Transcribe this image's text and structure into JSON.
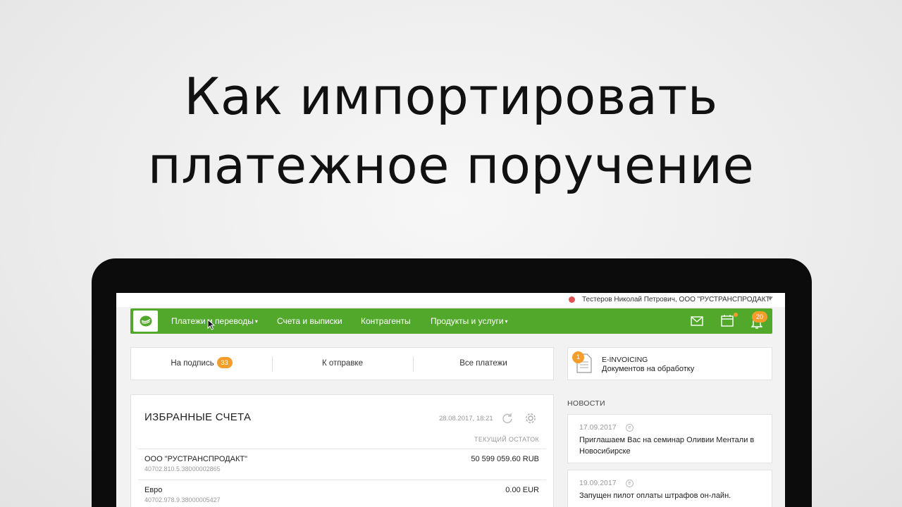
{
  "headline": {
    "line1": "Как импортировать",
    "line2": "платежное поручение"
  },
  "userbar": {
    "status_color": "#e05252",
    "user": "Тестеров Николай Петрович, ООО \"РУСТРАНСПРОДАКТ\"",
    "caret": "▼"
  },
  "nav": {
    "brand_color": "#52a82b",
    "items": [
      {
        "label": "Платежи и переводы",
        "dropdown": "▾"
      },
      {
        "label": "Счета и выписки"
      },
      {
        "label": "Контрагенты"
      },
      {
        "label": "Продукты и услуги",
        "dropdown": "▾"
      }
    ],
    "icons": [
      "mail-icon",
      "calendar-icon",
      "bell-icon"
    ],
    "notifications_count": "20"
  },
  "tabs": [
    {
      "label": "На подпись",
      "badge": "33"
    },
    {
      "label": "К отправке"
    },
    {
      "label": "Все платежи"
    }
  ],
  "einvoicing": {
    "badge": "1",
    "title": "E-INVOICING",
    "subtitle": "Документов на обработку"
  },
  "accounts": {
    "title": "ИЗБРАННЫЕ СЧЕТА",
    "updated": "28.08.2017, 18:21",
    "column_header": "ТЕКУЩИЙ ОСТАТОК",
    "rows": [
      {
        "name": "ООО \"РУСТРАНСПРОДАКТ\"",
        "number": "40702.810.5.38000002865",
        "balance": "50 599 059.60 RUB"
      },
      {
        "name": "Евро",
        "number": "40702.978.9.38000005427",
        "balance": "0.00 EUR"
      }
    ]
  },
  "news": {
    "title": "НОВОСТИ",
    "items": [
      {
        "date": "17.09.2017",
        "text": "Приглашаем Вас на семинар Оливии Ментали в Новосибирске"
      },
      {
        "date": "19.09.2017",
        "text": "Запущен пилот оплаты штрафов он-лайн."
      }
    ]
  },
  "accent_color": "#f59d2a"
}
